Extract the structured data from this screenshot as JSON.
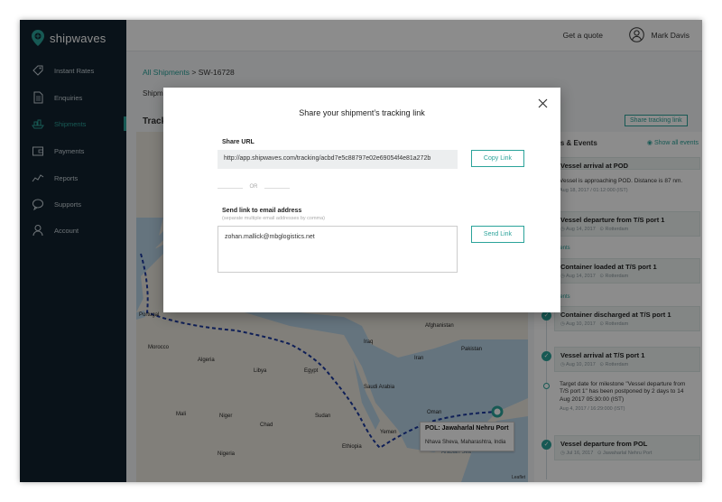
{
  "brand": {
    "name": "shipwaves",
    "accent": "#2ba39a",
    "sidebar_bg": "#12222e"
  },
  "sidebar": {
    "items": [
      {
        "label": "Instant Rates",
        "icon": "tag-icon"
      },
      {
        "label": "Enquiries",
        "icon": "document-icon"
      },
      {
        "label": "Shipments",
        "icon": "ship-icon",
        "active": true
      },
      {
        "label": "Payments",
        "icon": "wallet-icon"
      },
      {
        "label": "Reports",
        "icon": "chart-line-icon"
      },
      {
        "label": "Supports",
        "icon": "chat-icon"
      },
      {
        "label": "Account",
        "icon": "user-icon"
      }
    ]
  },
  "topbar": {
    "quote": "Get a quote",
    "user": "Mark Davis"
  },
  "breadcrumb": {
    "root": "All Shipments",
    "sep": ">",
    "current": "SW-16728"
  },
  "main": {
    "ship_label": "Shipm",
    "track_label": "Track",
    "share_button": "Share tracking link"
  },
  "map": {
    "countries": [
      "Portugal",
      "Morocco",
      "Algeria",
      "Libya",
      "Egypt",
      "Mali",
      "Niger",
      "Chad",
      "Sudan",
      "Nigeria",
      "Ethiopia",
      "Saudi Arabia",
      "Iraq",
      "Iran",
      "Pakistan",
      "Oman",
      "Yemen",
      "Afghanistan",
      "Arabian Sea"
    ],
    "pol_title": "POL: Jawaharlal Nehru Port",
    "pol_sub": "Nhava Sheva, Maharashtra, India",
    "attribution": "Leaflet"
  },
  "panel": {
    "title": "tones & Events",
    "show_all": "Show all events",
    "events": [
      {
        "title": "Vessel arrival at POD",
        "date": "",
        "place": ""
      },
      {
        "title": "",
        "text": "Vessel is approaching POD. Distance is 87 nm.",
        "date": "Aug 18, 2017 / 01:12:000 (IST)"
      },
      {
        "title": "Vessel departure from T/S port 1",
        "date": "Aug 14, 2017",
        "place": "Rotterdam"
      },
      {
        "title": "Container loaded at T/S port 1",
        "date": "Aug 14, 2017",
        "place": "Rotterdam"
      },
      {
        "title": "Container discharged at T/S port 1",
        "date": "Aug 10, 2017",
        "place": "Rotterdam"
      },
      {
        "title": "Vessel arrival at T/S port 1",
        "date": "Aug 10, 2017",
        "place": "Rotterdam"
      },
      {
        "title": "",
        "text": "Target date for milestone \"Vessel departure from T/S port 1\" has been postponed by 2 days to 14 Aug 2017 05:30:00 (IST)",
        "date": "Aug 4, 2017 / 16:29:000 (IST)"
      },
      {
        "title": "Vessel departure from POL",
        "date": "Jul 16, 2017",
        "place": "Jawaharlal Nehru Port"
      }
    ],
    "events_label": "events"
  },
  "modal": {
    "title": "Share your shipment’s tracking link",
    "url_label": "Share URL",
    "url": "http://app.shipwaves.com/tracking/acbd7e5c88797e02e69054f4e81a272b",
    "copy": "Copy Link",
    "or": "OR",
    "email_label": "Send link to email address",
    "email_hint": "(separate multiple email addresses by comma)",
    "email_value": "zohan.mallick@mbglogistics.net",
    "send": "Send Link"
  }
}
